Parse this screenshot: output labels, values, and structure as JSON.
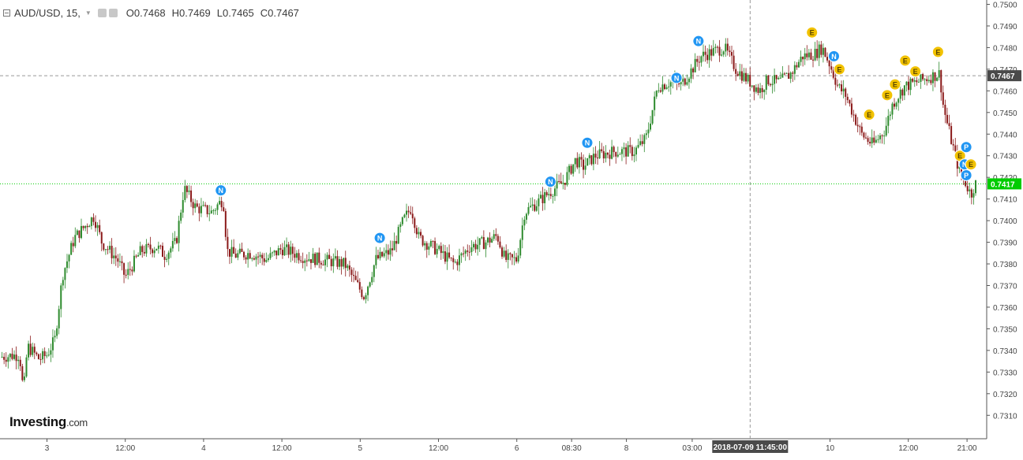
{
  "legend": {
    "symbol": "AUD/USD, 15,",
    "open": "O0.7468",
    "high": "H0.7469",
    "low": "L0.7465",
    "close": "C0.7467"
  },
  "brand": {
    "name": "Investing",
    "domain": ".com"
  },
  "colors": {
    "up": "#2e8b2e",
    "down": "#8b1a1a",
    "current_price": "#00cc00",
    "ref_line": "#999999",
    "news_badge": "#2196f3",
    "earnings_badge": "#f2c200",
    "crosshair_date_bg": "#4a4a4a"
  },
  "chart_data": {
    "type": "candlestick",
    "instrument": "AUD/USD",
    "interval": "15",
    "ylim": [
      0.7305,
      0.7502
    ],
    "y_ticks": [
      "0.7500",
      "0.7490",
      "0.7480",
      "0.7470",
      "0.7460",
      "0.7450",
      "0.7440",
      "0.7430",
      "0.7420",
      "0.7410",
      "0.7400",
      "0.7390",
      "0.7380",
      "0.7370",
      "0.7360",
      "0.7350",
      "0.7340",
      "0.7330",
      "0.7320",
      "0.7310"
    ],
    "x_ticks": [
      {
        "label": "3",
        "t": 0.6
      },
      {
        "label": "12:00",
        "t": 1.6
      },
      {
        "label": "4",
        "t": 2.6
      },
      {
        "label": "12:00",
        "t": 3.6
      },
      {
        "label": "5",
        "t": 4.6
      },
      {
        "label": "12:00",
        "t": 5.6
      },
      {
        "label": "6",
        "t": 6.6
      },
      {
        "label": "08:30",
        "t": 7.3
      },
      {
        "label": "8",
        "t": 8.0
      },
      {
        "label": "03:00",
        "t": 8.84
      },
      {
        "label": "10",
        "t": 10.6
      },
      {
        "label": "12:00",
        "t": 11.6
      },
      {
        "label": "21:00",
        "t": 12.35
      }
    ],
    "crosshair": {
      "date_label": "2018-07-09 11:45:00",
      "t": 9.58
    },
    "ref_price": {
      "value": 0.7467,
      "label": "0.7467"
    },
    "current_price": {
      "value": 0.7417,
      "label": "0.7417"
    },
    "price_path": [
      [
        0.0,
        0.7337
      ],
      [
        0.25,
        0.7338
      ],
      [
        0.3,
        0.732
      ],
      [
        0.35,
        0.7342
      ],
      [
        0.5,
        0.7336
      ],
      [
        0.6,
        0.7338
      ],
      [
        0.7,
        0.7345
      ],
      [
        0.8,
        0.7375
      ],
      [
        0.95,
        0.7392
      ],
      [
        1.1,
        0.7398
      ],
      [
        1.2,
        0.7402
      ],
      [
        1.3,
        0.739
      ],
      [
        1.5,
        0.7382
      ],
      [
        1.6,
        0.7374
      ],
      [
        1.8,
        0.7386
      ],
      [
        2.0,
        0.7388
      ],
      [
        2.1,
        0.7384
      ],
      [
        2.25,
        0.739
      ],
      [
        2.35,
        0.7415
      ],
      [
        2.5,
        0.7406
      ],
      [
        2.7,
        0.7404
      ],
      [
        2.85,
        0.741
      ],
      [
        2.9,
        0.7386
      ],
      [
        3.0,
        0.7384
      ],
      [
        3.2,
        0.7385
      ],
      [
        3.4,
        0.7382
      ],
      [
        3.6,
        0.7387
      ],
      [
        3.9,
        0.7383
      ],
      [
        4.1,
        0.7382
      ],
      [
        4.4,
        0.738
      ],
      [
        4.65,
        0.7365
      ],
      [
        4.8,
        0.7382
      ],
      [
        5.0,
        0.7386
      ],
      [
        5.15,
        0.74
      ],
      [
        5.25,
        0.7406
      ],
      [
        5.35,
        0.7392
      ],
      [
        5.6,
        0.7386
      ],
      [
        5.8,
        0.738
      ],
      [
        6.0,
        0.7388
      ],
      [
        6.2,
        0.739
      ],
      [
        6.35,
        0.7393
      ],
      [
        6.45,
        0.7382
      ],
      [
        6.6,
        0.7382
      ],
      [
        6.7,
        0.7404
      ],
      [
        6.85,
        0.7408
      ],
      [
        7.05,
        0.7414
      ],
      [
        7.2,
        0.7418
      ],
      [
        7.35,
        0.7428
      ],
      [
        7.45,
        0.7425
      ],
      [
        7.6,
        0.743
      ],
      [
        7.85,
        0.7432
      ],
      [
        8.1,
        0.7432
      ],
      [
        8.25,
        0.7438
      ],
      [
        8.4,
        0.7462
      ],
      [
        8.55,
        0.7464
      ],
      [
        8.7,
        0.7463
      ],
      [
        8.8,
        0.7468
      ],
      [
        8.95,
        0.7476
      ],
      [
        9.1,
        0.7478
      ],
      [
        9.25,
        0.748
      ],
      [
        9.4,
        0.747
      ],
      [
        9.55,
        0.7465
      ],
      [
        9.7,
        0.746
      ],
      [
        9.8,
        0.7465
      ],
      [
        9.95,
        0.7464
      ],
      [
        10.1,
        0.7468
      ],
      [
        10.25,
        0.7476
      ],
      [
        10.4,
        0.7477
      ],
      [
        10.5,
        0.748
      ],
      [
        10.6,
        0.7472
      ],
      [
        10.7,
        0.7462
      ],
      [
        10.8,
        0.7458
      ],
      [
        11.0,
        0.744
      ],
      [
        11.15,
        0.7435
      ],
      [
        11.3,
        0.7442
      ],
      [
        11.4,
        0.7454
      ],
      [
        11.55,
        0.7462
      ],
      [
        11.7,
        0.7464
      ],
      [
        11.85,
        0.7466
      ],
      [
        12.0,
        0.7468
      ],
      [
        12.05,
        0.7452
      ],
      [
        12.15,
        0.7437
      ],
      [
        12.25,
        0.7423
      ],
      [
        12.35,
        0.7416
      ],
      [
        12.4,
        0.7412
      ],
      [
        12.45,
        0.7417
      ]
    ],
    "events": [
      {
        "label": "N",
        "t": 2.82,
        "price": 0.7414
      },
      {
        "label": "N",
        "t": 4.85,
        "price": 0.7392
      },
      {
        "label": "N",
        "t": 7.03,
        "price": 0.7418
      },
      {
        "label": "N",
        "t": 7.5,
        "price": 0.7436
      },
      {
        "label": "N",
        "t": 8.64,
        "price": 0.7466
      },
      {
        "label": "N",
        "t": 8.92,
        "price": 0.7483
      },
      {
        "label": "E",
        "t": 10.37,
        "price": 0.7487
      },
      {
        "label": "N",
        "t": 10.65,
        "price": 0.7476
      },
      {
        "label": "E",
        "t": 10.72,
        "price": 0.747
      },
      {
        "label": "E",
        "t": 11.1,
        "price": 0.7449
      },
      {
        "label": "E",
        "t": 11.33,
        "price": 0.7458
      },
      {
        "label": "E",
        "t": 11.43,
        "price": 0.7463
      },
      {
        "label": "E",
        "t": 11.56,
        "price": 0.7474
      },
      {
        "label": "E",
        "t": 11.69,
        "price": 0.7469
      },
      {
        "label": "E",
        "t": 11.98,
        "price": 0.7478
      },
      {
        "label": "E",
        "t": 12.26,
        "price": 0.743
      },
      {
        "label": "N",
        "t": 12.32,
        "price": 0.7426
      },
      {
        "label": "P",
        "t": 12.34,
        "price": 0.7434
      },
      {
        "label": "E",
        "t": 12.4,
        "price": 0.7426
      },
      {
        "label": "P",
        "t": 12.34,
        "price": 0.7421
      }
    ]
  }
}
